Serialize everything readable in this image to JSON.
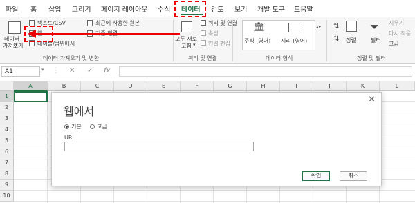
{
  "tabs": [
    "파일",
    "홈",
    "삽입",
    "그리기",
    "페이지 레이아웃",
    "수식",
    "데이터",
    "검토",
    "보기",
    "개발 도구",
    "도움말"
  ],
  "active_tab": "데이터",
  "ribbon": {
    "get_data": {
      "big_button_line1": "데이터",
      "big_button_line2": "가져오기",
      "text_csv": "텍스트/CSV",
      "web": "웹",
      "table_range": "테이블/범위에서",
      "recent_sources": "최근에 사용한 원본",
      "existing_connections": "기존 연결",
      "group_label": "데이터 가져오기 및 변환"
    },
    "queries": {
      "refresh_all_line1": "모두 새로",
      "refresh_all_line2": "고침",
      "queries_connections": "쿼리 및 연결",
      "properties": "속성",
      "edit_links": "연결 편집",
      "group_label": "쿼리 및 연결"
    },
    "data_types": {
      "stocks": "주식 (영어)",
      "geography": "지리 (영어)",
      "group_label": "데이터 형식"
    },
    "sort_filter": {
      "sort": "정렬",
      "filter": "필터",
      "clear": "지우기",
      "reapply": "다시 적용",
      "advanced": "고급",
      "group_label": "정렬 및 필터"
    }
  },
  "formula_bar": {
    "name_box": "A1",
    "cancel_symbol": "✕",
    "enter_symbol": "✓",
    "fx_symbol": "fx",
    "value": ""
  },
  "grid": {
    "columns": [
      "A",
      "B",
      "C",
      "D",
      "E",
      "F",
      "G",
      "H",
      "I",
      "J",
      "K",
      "L"
    ],
    "rows": [
      "1",
      "2",
      "3",
      "4",
      "5",
      "6",
      "7",
      "8",
      "9",
      "10"
    ]
  },
  "dialog": {
    "title": "웹에서",
    "close_symbol": "✕",
    "radio_basic": "기본",
    "radio_advanced": "고급",
    "selected_mode": "기본",
    "url_label": "URL",
    "url_value": "",
    "ok_button": "확인",
    "cancel_button": "취소"
  },
  "colors": {
    "accent": "#217346",
    "highlight": "#ee0000"
  }
}
